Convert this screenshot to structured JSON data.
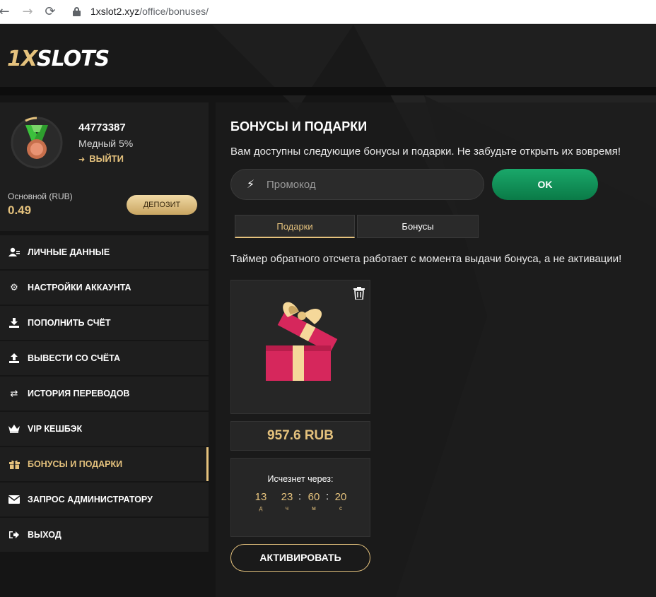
{
  "browser": {
    "url_host": "1xslot2.xyz",
    "url_path": "/office/bonuses/"
  },
  "header": {
    "logo_prefix": "1X",
    "logo_suffix": "SLOTS"
  },
  "profile": {
    "user_id": "44773387",
    "level": "Медный 5%",
    "logout_label": "ВЫЙТИ",
    "balance_label": "Основной (RUB)",
    "balance_value": "0.49",
    "deposit_label": "ДЕПОЗИТ"
  },
  "menu": {
    "items": [
      {
        "label": "ЛИЧНЫЕ ДАННЫЕ",
        "icon": "user-card-icon"
      },
      {
        "label": "НАСТРОЙКИ АККАУНТА",
        "icon": "gears-icon"
      },
      {
        "label": "ПОПОЛНИТЬ СЧЁТ",
        "icon": "download-icon"
      },
      {
        "label": "ВЫВЕСТИ СО СЧЁТА",
        "icon": "upload-icon"
      },
      {
        "label": "ИСТОРИЯ ПЕРЕВОДОВ",
        "icon": "exchange-icon"
      },
      {
        "label": "VIP КЕШБЭК",
        "icon": "crown-icon"
      },
      {
        "label": "БОНУСЫ И ПОДАРКИ",
        "icon": "gift-icon",
        "active": true
      },
      {
        "label": "ЗАПРОС АДМИНИСТРАТОРУ",
        "icon": "envelope-icon"
      },
      {
        "label": "ВЫХОД",
        "icon": "logout-icon"
      }
    ]
  },
  "main": {
    "title": "БОНУСЫ И ПОДАРКИ",
    "subtitle": "Вам доступны следующие бонусы и подарки. Не забудьте открыть их вовремя!",
    "promo_placeholder": "Промокод",
    "ok_label": "OK",
    "tabs": [
      {
        "label": "Подарки",
        "active": true
      },
      {
        "label": "Бонусы",
        "active": false
      }
    ],
    "timer_note": "Таймер обратного отсчета работает с момента выдачи бонуса, а не активации!",
    "gift": {
      "amount": "957.6 RUB",
      "expire_label": "Исчезнет через:",
      "countdown": [
        {
          "value": "13",
          "unit": "д"
        },
        {
          "value": "23",
          "unit": "ч"
        },
        {
          "value": "60",
          "unit": "м"
        },
        {
          "value": "20",
          "unit": "с"
        }
      ],
      "activate_label": "АКТИВИРОВАТЬ"
    }
  },
  "colors": {
    "accent_gold": "#e5c27d",
    "ok_green": "#10935a",
    "gift_red": "#d6275c",
    "gift_ribbon": "#f5d89a"
  }
}
